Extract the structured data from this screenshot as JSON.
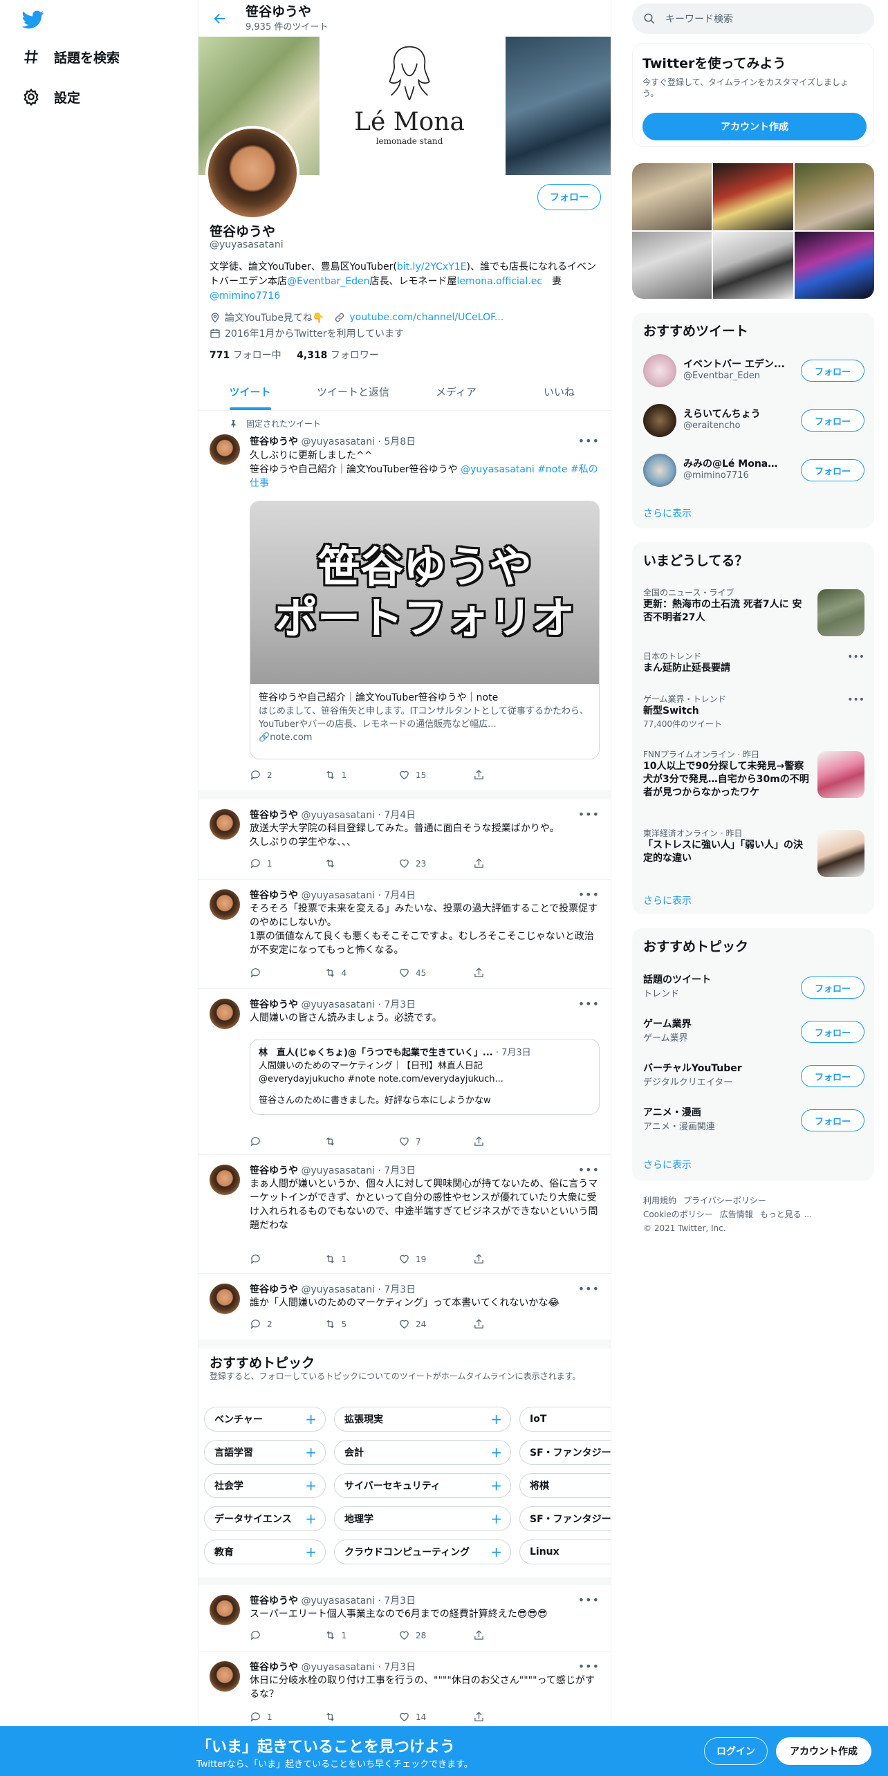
{
  "nav": {
    "explore_label": "話題を検索",
    "settings_label": "設定"
  },
  "header": {
    "name": "笹谷ゆうや",
    "tweet_count": "9,935 件のツイート"
  },
  "banner": {
    "brand": "Lé Mona",
    "sub": "lemonade stand"
  },
  "profile": {
    "follow_label": "フォロー",
    "name": "笹谷ゆうや",
    "handle": "@yuyasasatani",
    "bio_1": "文学徒、論文YouTuber、豊島区YouTuber(",
    "bio_link1": "bit.ly/2YCxY1E",
    "bio_2": ")、誰でも店長になれるイベントバーエデン本店",
    "bio_link2": "@Eventbar_Eden",
    "bio_3": "店長、レモネード屋",
    "bio_link3": "lemona.official.ec",
    "bio_4": "　妻",
    "bio_link4": "@mimino7716",
    "location": "論文YouTube見てね👇",
    "url": "youtube.com/channel/UCeLOF...",
    "joined": "2016年1月からTwitterを利用しています",
    "following_count": "771",
    "following_label": "フォロー中",
    "followers_count": "4,318",
    "followers_label": "フォロワー"
  },
  "tabs": [
    "ツイート",
    "ツイートと返信",
    "メディア",
    "いいね"
  ],
  "pinned_label": "固定されたツイート",
  "tweets": [
    {
      "name": "笹谷ゆうや",
      "meta": "@yuyasasatani · 5月8日",
      "text_1": "久しぶりに更新しました^^\n笹谷ゆうや自己紹介｜論文YouTuber笹谷ゆうや ",
      "text_link": "@yuyasasatani #note #私の仕事",
      "replies": "2",
      "retweets": "1",
      "likes": "15"
    },
    {
      "name": "笹谷ゆうや",
      "meta": "@yuyasasatani · 7月4日",
      "text": "放送大学大学院の科目登録してみた。普通に面白そうな授業ばかりや。\n久しぶりの学生やな、、、",
      "replies": "1",
      "retweets": "",
      "likes": "23"
    },
    {
      "name": "笹谷ゆうや",
      "meta": "@yuyasasatani · 7月4日",
      "text": "そろそろ「投票で未来を変える」みたいな、投票の過大評価することで投票促すのやめにしないか。\n1票の価値なんて良くも悪くもそこそこですよ。むしろそこそこじゃないと政治が不安定になってもっと怖くなる。",
      "replies": "",
      "retweets": "4",
      "likes": "45"
    },
    {
      "name": "笹谷ゆうや",
      "meta": "@yuyasasatani · 7月3日",
      "text": "人間嫌いの皆さん読みましょう。必読です。",
      "replies": "",
      "retweets": "",
      "likes": "7"
    },
    {
      "name": "笹谷ゆうや",
      "meta": "@yuyasasatani · 7月3日",
      "text": "まぁ人間が嫌いというか、個々人に対して興味関心が持てないため、俗に言うマーケットインができず、かといって自分の感性やセンスが優れていたり大衆に受け入れられるものでもないので、中途半端すぎてビジネスができないといいう問題だわな",
      "replies": "",
      "retweets": "1",
      "likes": "19"
    },
    {
      "name": "笹谷ゆうや",
      "meta": "@yuyasasatani · 7月3日",
      "text": "誰か「人間嫌いのためのマーケティング」って本書いてくれないかな😂",
      "replies": "2",
      "retweets": "5",
      "likes": "24"
    },
    {
      "name": "笹谷ゆうや",
      "meta": "@yuyasasatani · 7月3日",
      "text": "スーパーエリート個人事業主なので6月までの経費計算終えた😎😎😎",
      "replies": "",
      "retweets": "1",
      "likes": "28"
    },
    {
      "name": "笹谷ゆうや",
      "meta": "@yuyasasatani · 7月3日",
      "text": "休日に分岐水栓の取り付け工事を行うの、\"\"\"\"休日のお父さん\"\"\"\"って感じがするな？",
      "replies": "1",
      "retweets": "",
      "likes": "14"
    }
  ],
  "link_card": {
    "image_line1": "笹谷ゆうや",
    "image_line2": "ポートフォリオ",
    "title": "笹谷ゆうや自己紹介｜論文YouTuber笹谷ゆうや｜note",
    "desc": "はじめまして、笹谷侑矢と申します。ITコンサルタントとして従事するかたわら、YouTuberやバーの店長、レモネードの通信販売など幅広...",
    "domain": "note.com"
  },
  "quote": {
    "author": "林　直人(じゅくちょ)@「うつでも起業で生きていく」...",
    "date": "· 7月3日",
    "line1": "人間嫌いのためのマーケティング｜【日刊】林直人日記",
    "line2": "@everydayjukucho #note note.com/everydayjukuch...",
    "line3": "笹谷さんのために書きました。好評なら本にしようかなw"
  },
  "topics": {
    "title": "おすすめトピック",
    "subtitle": "登録すると、フォローしているトピックについてのツイートがホームタイムラインに表示されます。",
    "chips": [
      [
        "ベンチャー",
        "拡張現実",
        "IoT"
      ],
      [
        "言語学習",
        "会計",
        "SF・ファンタジー"
      ],
      [
        "社会学",
        "サイバーセキュリティ",
        "将棋"
      ],
      [
        "データサイエンス",
        "地理学",
        "SF・ファンタジー"
      ],
      [
        "教育",
        "クラウドコンピューティング",
        "Linux"
      ]
    ]
  },
  "right": {
    "search_placeholder": "キーワード検索",
    "signup_title": "Twitterを使ってみよう",
    "signup_desc": "今すぐ登録して、タイムラインをカスタマイズしましょう。",
    "signup_button": "アカウント作成",
    "rec_tweets_title": "おすすめツイート",
    "rec_users": [
      {
        "name": "イベントバー エデン...",
        "handle": "@Eventbar_Eden"
      },
      {
        "name": "えらいてんちょう",
        "handle": "@eraitencho"
      },
      {
        "name": "みみの@Lé Monaレ...",
        "handle": "@mimino7716"
      }
    ],
    "follow_label": "フォロー",
    "show_more": "さらに表示",
    "trends_title": "いまどうしてる？",
    "trends": [
      {
        "meta": "全国のニュース・ライブ",
        "title": "更新：熱海市の土石流 死者7人に 安否不明者27人"
      },
      {
        "meta": "日本のトレンド",
        "title": "まん延防止延長要請"
      },
      {
        "meta": "ゲーム業界・トレンド",
        "title": "新型Switch",
        "sub": "77,400件のツイート"
      },
      {
        "meta": "FNNプライムオンライン · 昨日",
        "title": "10人以上で90分探して未発見→警察犬が3分で発見…自宅から30mの不明者が見つからなかったワケ"
      },
      {
        "meta": "東洋経済オンライン · 昨日",
        "title": "「ストレスに強い人」「弱い人」の決定的な違い"
      }
    ],
    "topics_title": "おすすめトピック",
    "topics": [
      {
        "name": "話題のツイート",
        "cat": "トレンド"
      },
      {
        "name": "ゲーム業界",
        "cat": "ゲーム業界"
      },
      {
        "name": "バーチャルYouTuber",
        "cat": "デジタルクリエイター"
      },
      {
        "name": "アニメ・漫画",
        "cat": "アニメ・漫画関連"
      }
    ],
    "footer_1": "利用規約",
    "footer_2": "プライバシーポリシー",
    "footer_3": "Cookieのポリシー",
    "footer_4": "広告情報",
    "footer_5": "もっと見る ...",
    "footer_6": "© 2021 Twitter, Inc."
  },
  "bottom_bar": {
    "title": "「いま」起きていることを見つけよう",
    "subtitle": "Twitterなら、「いま」起きていることをいち早くチェックできます。",
    "login": "ログイン",
    "signup": "アカウント作成"
  }
}
